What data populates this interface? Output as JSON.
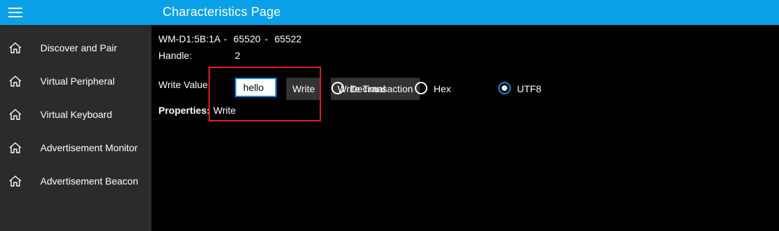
{
  "header": {
    "title": "Characteristics Page",
    "menu_icon": "hamburger-icon"
  },
  "sidebar": {
    "items": [
      {
        "label": "Discover and Pair",
        "icon": "home-icon"
      },
      {
        "label": "Virtual Peripheral",
        "icon": "home-icon"
      },
      {
        "label": "Virtual Keyboard",
        "icon": "home-icon"
      },
      {
        "label": "Advertisement Monitor",
        "icon": "home-icon"
      },
      {
        "label": "Advertisement Beacon",
        "icon": "home-icon"
      }
    ]
  },
  "main": {
    "device_id": "WM-D1:5B:1A",
    "sep1": "-",
    "service_id": "65520",
    "sep2": "-",
    "characteristic_id": "65522",
    "handle_label": "Handle:",
    "handle_value": "2",
    "write_value_label": "Write Value",
    "input_value": "hello",
    "write_button": "Write",
    "write_transaction_button": "Write Transaction",
    "radio_decimal": "Decimal",
    "radio_hex": "Hex",
    "radio_utf8": "UTF8",
    "selected_format": "UTF8",
    "properties_label": "Properties:",
    "properties_value": "Write"
  },
  "colors": {
    "accent": "#0aa0e8",
    "sidebar": "#2b2b2b",
    "highlight": "#e02020"
  }
}
